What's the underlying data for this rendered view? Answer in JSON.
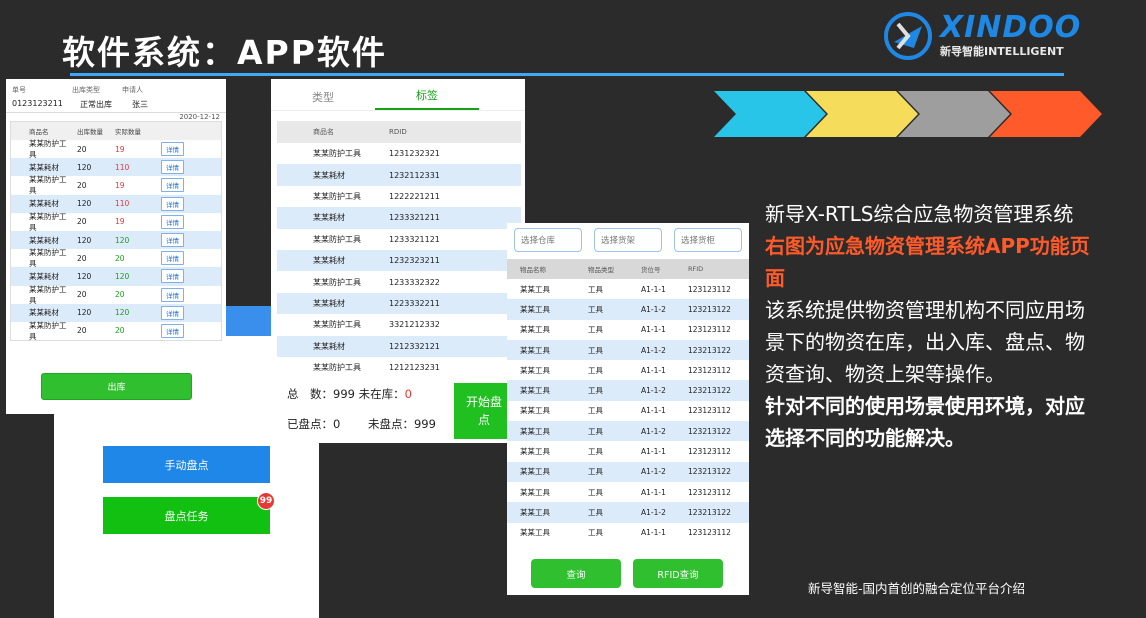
{
  "slide": {
    "title": "软件系统：APP软件",
    "logo_text": "XINDOO",
    "logo_sub": "新导智能INTELLIGENT",
    "footer": "新导智能-国内首创的融合定位平台介绍",
    "colors": {
      "accent": "#3fa9f5",
      "orange": "#ff5a2a",
      "green": "#17a317",
      "blue": "#1f87e8"
    }
  },
  "description": {
    "line1": "新导X-RTLS综合应急物资管理系统",
    "line2": "右图为应急物资管理系统APP功能页",
    "line3": "面",
    "line4": "该系统提供物资管理机构不同应用场",
    "line5": "景下的物资在库，出入库、盘点、物",
    "line6": "资查询、物资上架等操作。",
    "line7": "针对不同的使用场景使用环境，对应",
    "line8": "选择不同的功能解决。"
  },
  "outbound_screen": {
    "headers": [
      "单号",
      "出库类型",
      "申请人"
    ],
    "values": [
      "0123123211",
      "正常出库",
      "张三"
    ],
    "date": "2020-12-12",
    "columns": [
      "商品名",
      "出库数量",
      "实际数量"
    ],
    "detail_label": "详情",
    "rows": [
      {
        "name": "某某防护工具",
        "out": "20",
        "actual": "19",
        "status": "red"
      },
      {
        "name": "某某耗材",
        "out": "120",
        "actual": "110",
        "status": "red"
      },
      {
        "name": "某某防护工具",
        "out": "20",
        "actual": "19",
        "status": "red"
      },
      {
        "name": "某某耗材",
        "out": "120",
        "actual": "110",
        "status": "red"
      },
      {
        "name": "某某防护工具",
        "out": "20",
        "actual": "19",
        "status": "red"
      },
      {
        "name": "某某耗材",
        "out": "120",
        "actual": "120",
        "status": "green"
      },
      {
        "name": "某某防护工具",
        "out": "20",
        "actual": "20",
        "status": "green"
      },
      {
        "name": "某某耗材",
        "out": "120",
        "actual": "120",
        "status": "green"
      },
      {
        "name": "某某防护工具",
        "out": "20",
        "actual": "20",
        "status": "green"
      },
      {
        "name": "某某耗材",
        "out": "120",
        "actual": "120",
        "status": "green"
      },
      {
        "name": "某某防护工具",
        "out": "20",
        "actual": "20",
        "status": "green"
      }
    ],
    "out_button": "出库"
  },
  "back_screen": {
    "manual_button": "手动盘点",
    "task_button": "盘点任务",
    "task_badge": "99"
  },
  "inventory_screen": {
    "tabs": [
      "类型",
      "标签"
    ],
    "active_tab": 1,
    "columns": [
      "商品名",
      "RDID"
    ],
    "rows": [
      {
        "name": "某某防护工具",
        "id": "1231232321"
      },
      {
        "name": "某某耗材",
        "id": "1232112331"
      },
      {
        "name": "某某防护工具",
        "id": "1222221211"
      },
      {
        "name": "某某耗材",
        "id": "1233321211"
      },
      {
        "name": "某某防护工具",
        "id": "1233321121"
      },
      {
        "name": "某某耗材",
        "id": "1232323211"
      },
      {
        "name": "某某防护工具",
        "id": "1233332322"
      },
      {
        "name": "某某耗材",
        "id": "1223332211"
      },
      {
        "name": "某某防护工具",
        "id": "3321212332"
      },
      {
        "name": "某某耗材",
        "id": "1212332121"
      },
      {
        "name": "某某防护工具",
        "id": "1212123231"
      }
    ],
    "total_label": "总　数：",
    "total_value": "999",
    "not_in_label": "未在库：",
    "not_in_value": "0",
    "counted_label": "已盘点：",
    "counted_value": "0",
    "uncounted_label": "未盘点：",
    "uncounted_value": "999",
    "start_button": "开始盘点"
  },
  "query_screen": {
    "filters": [
      "选择仓库",
      "选择货架",
      "选择货柜"
    ],
    "columns": [
      "物品名称",
      "物品类型",
      "货位号",
      "RFID"
    ],
    "rows": [
      [
        "某某工具",
        "工具",
        "A1-1-1",
        "123123112"
      ],
      [
        "某某工具",
        "工具",
        "A1-1-2",
        "123213122"
      ],
      [
        "某某工具",
        "工具",
        "A1-1-1",
        "123123112"
      ],
      [
        "某某工具",
        "工具",
        "A1-1-2",
        "123213122"
      ],
      [
        "某某工具",
        "工具",
        "A1-1-1",
        "123123112"
      ],
      [
        "某某工具",
        "工具",
        "A1-1-2",
        "123213122"
      ],
      [
        "某某工具",
        "工具",
        "A1-1-1",
        "123123112"
      ],
      [
        "某某工具",
        "工具",
        "A1-1-2",
        "123213122"
      ],
      [
        "某某工具",
        "工具",
        "A1-1-1",
        "123123112"
      ],
      [
        "某某工具",
        "工具",
        "A1-1-2",
        "123213122"
      ],
      [
        "某某工具",
        "工具",
        "A1-1-1",
        "123123112"
      ],
      [
        "某某工具",
        "工具",
        "A1-1-2",
        "123213122"
      ],
      [
        "某某工具",
        "工具",
        "A1-1-1",
        "123123112"
      ]
    ],
    "query_button": "查询",
    "rfid_button": "RFID查询"
  }
}
